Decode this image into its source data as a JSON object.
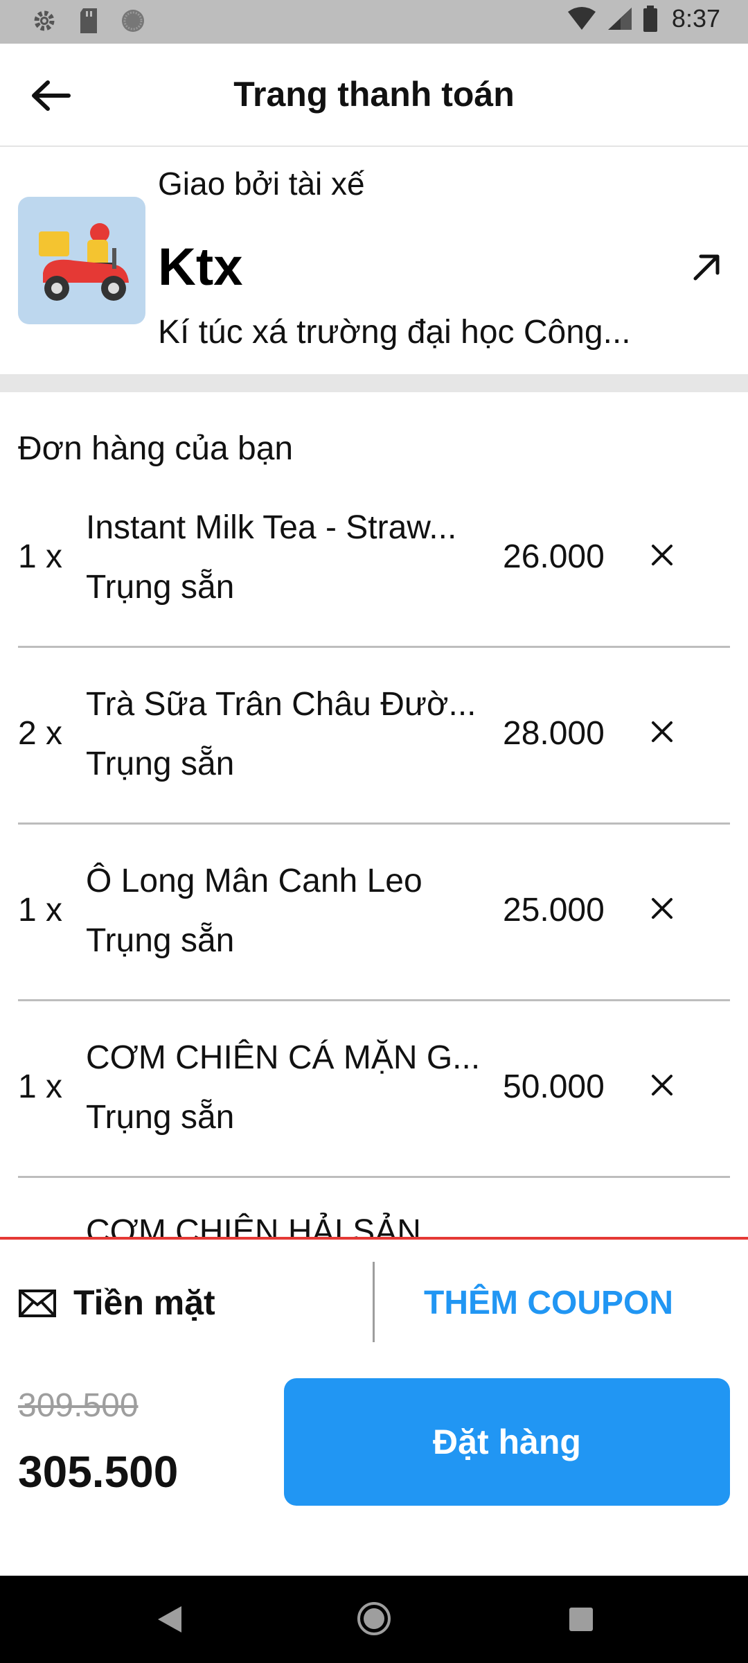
{
  "status_bar": {
    "time": "8:37"
  },
  "header": {
    "title": "Trang thanh toán"
  },
  "delivery": {
    "label": "Giao bởi tài xế",
    "name": "Ktx",
    "address": "Kí túc xá trường đại học Công..."
  },
  "order": {
    "heading": "Đơn hàng của bạn",
    "items": [
      {
        "qty": "1 x",
        "name": "Instant Milk Tea - Straw...",
        "sub": "Trụng sẵn",
        "price": "26.000"
      },
      {
        "qty": "2 x",
        "name": "Trà Sữa Trân Châu Đườ...",
        "sub": "Trụng sẵn",
        "price": "28.000"
      },
      {
        "qty": "1 x",
        "name": "Ô Long Mân Canh Leo",
        "sub": "Trụng sẵn",
        "price": "25.000"
      },
      {
        "qty": "1 x",
        "name": "CƠM CHIÊN CÁ MẶN G...",
        "sub": "Trụng sẵn",
        "price": "50.000"
      }
    ],
    "partial_item_name": "CƠM CHIÊN HẢI SẢN"
  },
  "payment": {
    "method": "Tiền mặt",
    "coupon_label": "THÊM COUPON",
    "original_total": "309.500",
    "total": "305.500",
    "order_button": "Đặt hàng"
  },
  "colors": {
    "accent": "#2196f3",
    "divider_red": "#e53935",
    "scooter_bg": "#bdd7ee"
  }
}
